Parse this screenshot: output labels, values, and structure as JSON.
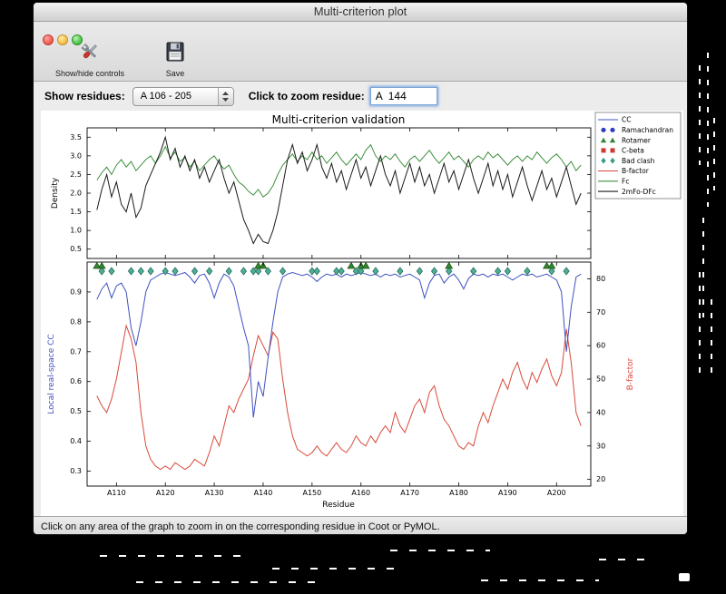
{
  "window": {
    "title": "Multi-criterion plot",
    "toolbar": {
      "show_hide_label": "Show/hide controls",
      "save_label": "Save"
    },
    "controls": {
      "show_residues_label": "Show residues:",
      "residue_range_value": "A 106 - 205",
      "zoom_residue_label": "Click to zoom residue:",
      "zoom_residue_value": "A  144"
    },
    "status_bar": "Click on any area of the graph to zoom in on the corresponding residue in Coot or PyMOL."
  },
  "chart_data": {
    "type": "line",
    "title": "Multi-criterion validation",
    "x_start": 106,
    "x_end": 205,
    "xlim": [
      104,
      207
    ],
    "xlabel": "Residue",
    "x_ticks": [
      {
        "pos": 110,
        "label": "A110"
      },
      {
        "pos": 120,
        "label": "A120"
      },
      {
        "pos": 130,
        "label": "A130"
      },
      {
        "pos": 140,
        "label": "A140"
      },
      {
        "pos": 150,
        "label": "A150"
      },
      {
        "pos": 160,
        "label": "A160"
      },
      {
        "pos": 170,
        "label": "A170"
      },
      {
        "pos": 180,
        "label": "A180"
      },
      {
        "pos": 190,
        "label": "A190"
      },
      {
        "pos": 200,
        "label": "A200"
      }
    ],
    "legend": {
      "position": "top-right-outside",
      "entries": [
        {
          "label": "CC",
          "glyph": "line",
          "color": "#3f51c1"
        },
        {
          "label": "Ramachandran",
          "glyph": "circles",
          "color": "#2f3ec0"
        },
        {
          "label": "Rotamer",
          "glyph": "triangles",
          "color": "#33872f"
        },
        {
          "label": "C-beta",
          "glyph": "squares",
          "color": "#cc3b2f"
        },
        {
          "label": "Bad clash",
          "glyph": "diamonds",
          "color": "#3a9b87"
        },
        {
          "label": "B-factor",
          "glyph": "line",
          "color": "#d84a3a"
        },
        {
          "label": "Fc",
          "glyph": "line",
          "color": "#3f8f3f"
        },
        {
          "label": "2mFo-DFc",
          "glyph": "line",
          "color": "#1a1a1a"
        }
      ]
    },
    "top_plot": {
      "ylabel": "Density",
      "ylim": [
        0.25,
        3.75
      ],
      "yticks": [
        0.5,
        1.0,
        1.5,
        2.0,
        2.5,
        3.0,
        3.5
      ],
      "series": [
        {
          "name": "Fc",
          "color": "#3f8f3f",
          "values": [
            2.35,
            2.55,
            2.7,
            2.5,
            2.75,
            2.9,
            2.7,
            2.85,
            2.6,
            2.75,
            2.9,
            3.0,
            2.8,
            3.0,
            3.25,
            2.95,
            3.1,
            2.85,
            2.95,
            2.7,
            2.85,
            2.6,
            2.75,
            2.9,
            3.0,
            2.8,
            2.65,
            2.75,
            2.5,
            2.3,
            2.2,
            2.05,
            1.95,
            2.1,
            1.9,
            2.0,
            2.2,
            2.5,
            2.75,
            2.9,
            3.05,
            2.85,
            3.0,
            2.9,
            3.1,
            2.9,
            3.0,
            2.8,
            2.95,
            3.1,
            2.9,
            2.75,
            2.9,
            3.05,
            2.9,
            3.15,
            3.3,
            3.0,
            2.85,
            3.0,
            2.9,
            3.05,
            2.85,
            2.7,
            2.9,
            3.0,
            2.85,
            3.0,
            3.15,
            2.95,
            2.8,
            2.95,
            3.1,
            2.9,
            3.0,
            2.85,
            2.7,
            2.9,
            3.0,
            2.9,
            3.1,
            2.95,
            3.05,
            2.9,
            2.75,
            2.9,
            3.0,
            2.85,
            3.0,
            2.9,
            3.1,
            2.95,
            2.8,
            2.95,
            3.05,
            2.9,
            2.7,
            2.85,
            2.6,
            2.75
          ]
        },
        {
          "name": "2mFo-DFc",
          "color": "#1a1a1a",
          "values": [
            1.55,
            2.1,
            2.5,
            1.9,
            2.3,
            1.7,
            1.5,
            2.0,
            1.35,
            1.6,
            2.2,
            2.5,
            2.8,
            3.1,
            3.5,
            2.9,
            3.2,
            2.7,
            3.0,
            2.6,
            2.9,
            2.4,
            2.7,
            2.3,
            2.6,
            2.9,
            2.4,
            2.0,
            2.3,
            1.8,
            1.3,
            1.0,
            0.65,
            0.9,
            0.7,
            0.65,
            1.0,
            1.5,
            2.2,
            2.9,
            3.3,
            2.8,
            3.1,
            2.6,
            2.9,
            3.3,
            2.7,
            2.4,
            2.8,
            2.3,
            2.6,
            2.1,
            2.5,
            2.9,
            2.4,
            2.7,
            2.2,
            2.6,
            3.0,
            2.5,
            2.2,
            2.6,
            2.0,
            2.4,
            2.8,
            2.3,
            2.7,
            2.2,
            2.5,
            2.0,
            2.4,
            2.8,
            2.3,
            2.6,
            2.1,
            2.5,
            2.9,
            2.4,
            2.0,
            2.4,
            2.8,
            2.2,
            2.6,
            2.1,
            2.5,
            1.9,
            2.3,
            2.7,
            2.2,
            1.8,
            2.2,
            2.6,
            2.1,
            2.4,
            1.9,
            2.3,
            2.7,
            2.2,
            1.7,
            2.0
          ]
        }
      ]
    },
    "bottom_plot": {
      "ylabel_left": "Local real-space CC",
      "ylabel_left_color": "#3f51c1",
      "ylabel_right": "B-factor",
      "ylabel_right_color": "#d84a3a",
      "ylim_left": [
        0.25,
        1.0
      ],
      "yticks_left": [
        0.3,
        0.4,
        0.5,
        0.6,
        0.7,
        0.8,
        0.9
      ],
      "ylim_right": [
        18,
        85
      ],
      "yticks_right": [
        20,
        30,
        40,
        50,
        60,
        70,
        80
      ],
      "cc_series": {
        "name": "CC",
        "color": "#3f51c1",
        "values": [
          0.875,
          0.91,
          0.93,
          0.88,
          0.92,
          0.93,
          0.9,
          0.78,
          0.72,
          0.8,
          0.9,
          0.94,
          0.95,
          0.96,
          0.965,
          0.96,
          0.955,
          0.96,
          0.965,
          0.95,
          0.93,
          0.955,
          0.96,
          0.93,
          0.88,
          0.93,
          0.96,
          0.95,
          0.92,
          0.85,
          0.78,
          0.72,
          0.48,
          0.6,
          0.55,
          0.68,
          0.8,
          0.9,
          0.95,
          0.96,
          0.965,
          0.96,
          0.955,
          0.96,
          0.95,
          0.935,
          0.95,
          0.96,
          0.955,
          0.96,
          0.95,
          0.96,
          0.955,
          0.96,
          0.965,
          0.96,
          0.955,
          0.96,
          0.95,
          0.96,
          0.955,
          0.96,
          0.95,
          0.955,
          0.96,
          0.95,
          0.94,
          0.88,
          0.93,
          0.955,
          0.96,
          0.93,
          0.95,
          0.96,
          0.94,
          0.91,
          0.945,
          0.96,
          0.955,
          0.96,
          0.95,
          0.96,
          0.955,
          0.96,
          0.95,
          0.94,
          0.95,
          0.96,
          0.955,
          0.96,
          0.95,
          0.955,
          0.96,
          0.95,
          0.94,
          0.9,
          0.7,
          0.85,
          0.95,
          0.96
        ]
      },
      "bfactor_series": {
        "name": "B-factor",
        "color": "#d84a3a",
        "values": [
          45,
          42,
          40,
          44,
          50,
          58,
          66,
          62,
          55,
          40,
          30,
          26,
          24,
          23,
          24,
          23,
          25,
          24,
          23,
          24,
          26,
          25,
          24,
          28,
          33,
          30,
          36,
          42,
          40,
          44,
          47,
          50,
          57,
          63,
          60,
          57,
          64,
          62,
          50,
          40,
          33,
          29,
          28,
          27,
          28,
          30,
          28,
          27,
          29,
          31,
          29,
          28,
          30,
          33,
          31,
          30,
          33,
          31,
          34,
          36,
          34,
          40,
          36,
          34,
          38,
          42,
          44,
          40,
          46,
          48,
          42,
          38,
          36,
          33,
          30,
          29,
          31,
          30,
          36,
          40,
          37,
          42,
          46,
          50,
          47,
          52,
          55,
          50,
          47,
          52,
          49,
          53,
          56,
          51,
          48,
          52,
          65,
          55,
          40,
          36
        ]
      },
      "markers": {
        "bad_clash": {
          "color": "#4fae97",
          "edge": "#256f5d",
          "residues": [
            107,
            109,
            113,
            115,
            117,
            120,
            122,
            126,
            129,
            133,
            136,
            138,
            139,
            141,
            144,
            150,
            151,
            155,
            156,
            159,
            160,
            163,
            168,
            172,
            175,
            178,
            183,
            188,
            190,
            194,
            199,
            202
          ]
        },
        "rotamer_outlier": {
          "color": "#33872f",
          "edge": "#1c5419",
          "residues": [
            106,
            107,
            139,
            140,
            158,
            160,
            161,
            178,
            198,
            199
          ]
        }
      }
    }
  }
}
